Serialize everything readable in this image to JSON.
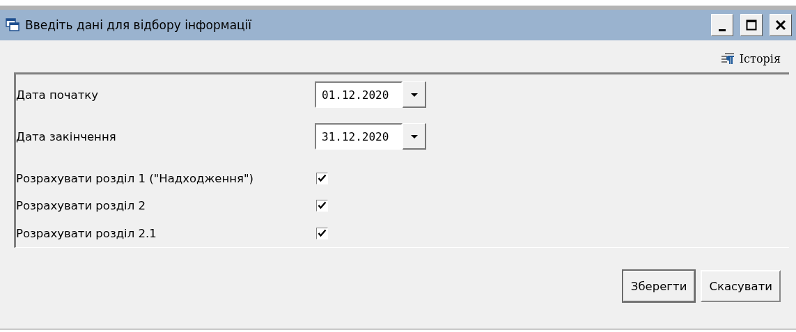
{
  "window": {
    "title": "Введіть дані для відбору інформації"
  },
  "toolbar": {
    "history_label": "Історія"
  },
  "fields": [
    {
      "kind": "date",
      "label": "Дата початку",
      "value": "01.12.2020"
    },
    {
      "kind": "date",
      "label": "Дата закінчення",
      "value": "31.12.2020"
    },
    {
      "kind": "checkbox",
      "label": "Розрахувати розділ 1 (\"Надходження\")",
      "checked": true
    },
    {
      "kind": "checkbox",
      "label": "Розрахувати розділ 2",
      "checked": true
    },
    {
      "kind": "checkbox",
      "label": "Розрахувати розділ 2.1",
      "checked": true
    }
  ],
  "buttons": [
    {
      "label": "Зберегти",
      "default": true
    },
    {
      "label": "Скасувати",
      "default": false
    }
  ]
}
